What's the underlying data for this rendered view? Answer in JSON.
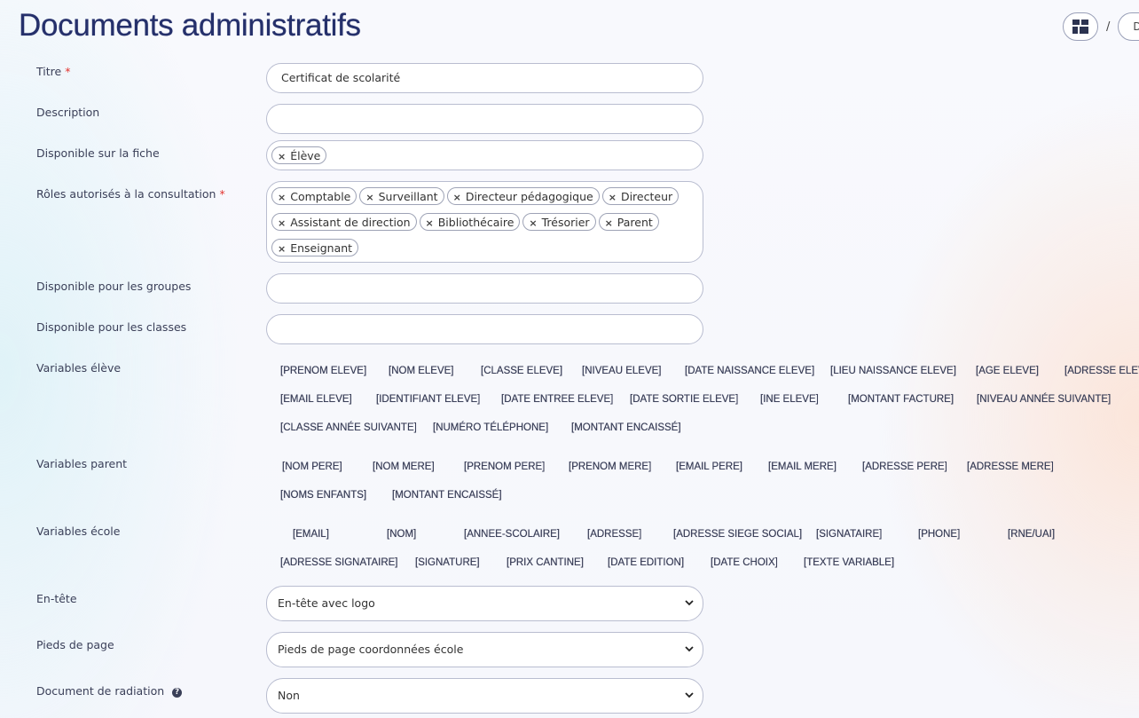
{
  "page": {
    "title": "Documents administratifs"
  },
  "top_actions": {
    "separator": "/",
    "crumb_label": "D"
  },
  "form": {
    "titre": {
      "label": "Titre",
      "required_mark": "*",
      "value": "Certificat de scolarité"
    },
    "description": {
      "label": "Description",
      "value": ""
    },
    "disponible_fiche": {
      "label": "Disponible sur la fiche",
      "tags": [
        "Élève"
      ]
    },
    "roles": {
      "label": "Rôles autorisés à la consultation",
      "required_mark": "*",
      "tags": [
        "Comptable",
        "Surveillant",
        "Directeur pédagogique",
        "Directeur",
        "Assistant de direction",
        "Bibliothécaire",
        "Trésorier",
        "Parent",
        "Enseignant"
      ]
    },
    "groupes": {
      "label": "Disponible pour les groupes",
      "value": ""
    },
    "classes": {
      "label": "Disponible pour les classes",
      "value": ""
    },
    "variables_eleve": {
      "label": "Variables élève",
      "items": [
        "[PRENOM ELEVE]",
        "[NOM ELEVE]",
        "[CLASSE ELEVE]",
        "[NIVEAU ELEVE]",
        "[DATE NAISSANCE ELEVE]",
        "[LIEU NAISSANCE ELEVE]",
        "[AGE ELEVE]",
        "[ADRESSE ELEVE",
        "[EMAIL ELEVE]",
        "[IDENTIFIANT ELEVE]",
        "[DATE ENTREE ELEVE]",
        "[DATE SORTIE ELEVE]",
        "[INE ELEVE]",
        "[MONTANT FACTURE]",
        "[NIVEAU ANNÉE SUIVANTE]",
        "[CLASSE ANNÉE SUIVANTE]",
        "[NUMÉRO TÉLÉPHONE]",
        "[MONTANT ENCAISSÉ]"
      ]
    },
    "variables_parent": {
      "label": "Variables parent",
      "items": [
        "[NOM PERE]",
        "[NOM MERE]",
        "[PRENOM PERE]",
        "[PRENOM MERE]",
        "[EMAIL PERE]",
        "[EMAIL MERE]",
        "[ADRESSE PERE]",
        "[ADRESSE MERE]",
        "[NOMS ENFANTS]",
        "[MONTANT ENCAISSÉ]"
      ]
    },
    "variables_ecole": {
      "label": "Variables école",
      "items": [
        "[EMAIL]",
        "[NOM]",
        "[ANNEE-SCOLAIRE]",
        "[ADRESSE]",
        "[ADRESSE SIEGE SOCIAL]",
        "[SIGNATAIRE]",
        "[PHONE]",
        "[RNE/UAI]",
        "[ADRESSE SIGNATAIRE]",
        "[SIGNATURE]",
        "[PRIX CANTINE]",
        "[DATE EDITION]",
        "[DATE CHOIX]",
        "[TEXTE VARIABLE]"
      ]
    },
    "entete": {
      "label": "En-tête",
      "selected": "En-tête avec logo"
    },
    "pieds": {
      "label": "Pieds de page",
      "selected": "Pieds de page coordonnées école"
    },
    "radiation": {
      "label": "Document de radiation",
      "help_icon": "?",
      "selected": "Non"
    }
  },
  "icons": {
    "grid": "dashboard-grid-icon",
    "remove": "×",
    "chevron": "chevron-down-icon",
    "help": "question-circle-icon"
  },
  "colors": {
    "title": "#25306b",
    "required": "#e3342f",
    "border": "#b9bdd0"
  }
}
